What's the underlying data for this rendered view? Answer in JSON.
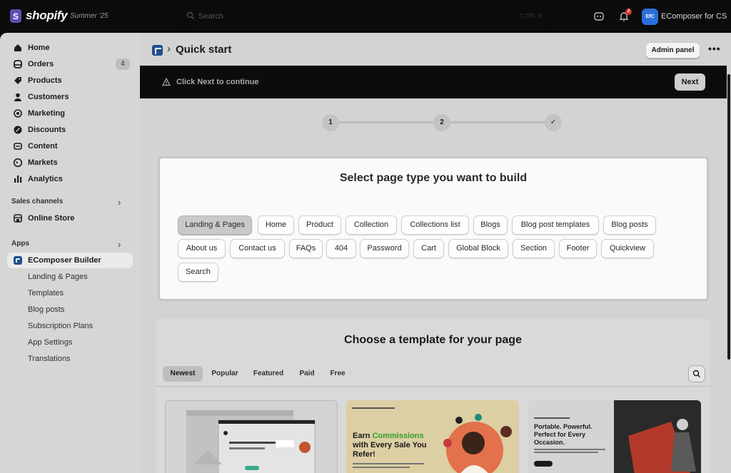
{
  "topbar": {
    "logo_mark": "S",
    "logo_text": "shopify",
    "edition": "Summer '25",
    "search_placeholder": "Search",
    "search_shortcut": "CTRL  K",
    "notification_count": "2",
    "avatar_initials": "EfC",
    "store_name": "EComposer for CS"
  },
  "sidebar": {
    "items": [
      {
        "label": "Home",
        "icon": "home-icon"
      },
      {
        "label": "Orders",
        "icon": "orders-icon",
        "badge": "4"
      },
      {
        "label": "Products",
        "icon": "tag-icon"
      },
      {
        "label": "Customers",
        "icon": "person-icon"
      },
      {
        "label": "Marketing",
        "icon": "target-icon"
      },
      {
        "label": "Discounts",
        "icon": "discount-icon"
      },
      {
        "label": "Content",
        "icon": "content-icon"
      },
      {
        "label": "Markets",
        "icon": "globe-icon"
      },
      {
        "label": "Analytics",
        "icon": "bar-chart-icon"
      }
    ],
    "sales_channels_heading": "Sales channels",
    "online_store": "Online Store",
    "apps_heading": "Apps",
    "app_name": "EComposer Builder",
    "app_subitems": [
      "Landing & Pages",
      "Templates",
      "Blog posts",
      "Subscription Plans",
      "App Settings",
      "Translations"
    ]
  },
  "page": {
    "breadcrumb_sep": "›",
    "title": "Quick start",
    "admin_panel": "Admin panel",
    "more": "•••"
  },
  "banner": {
    "text": "Click Next to continue",
    "next": "Next"
  },
  "stepper": {
    "steps": [
      "1",
      "2",
      "✓"
    ]
  },
  "select_page": {
    "title": "Select page type you want to build",
    "types": [
      "Landing & Pages",
      "Home",
      "Product",
      "Collection",
      "Collections list",
      "Blogs",
      "Blog post templates",
      "Blog posts",
      "About us",
      "Contact us",
      "FAQs",
      "404",
      "Password",
      "Cart",
      "Global Block",
      "Section",
      "Footer",
      "Quickview",
      "Search"
    ],
    "selected": "Landing & Pages"
  },
  "templates": {
    "title": "Choose a template for your page",
    "tabs": [
      "Newest",
      "Popular",
      "Featured",
      "Paid",
      "Free"
    ],
    "selected_tab": "Newest",
    "thumb2": {
      "line1a": "Earn ",
      "line1b": "Commissions",
      "line2": "with Every Sale You",
      "line3": "Refer!"
    },
    "thumb3": {
      "line1": "Portable. Powerful.",
      "line2": "Perfect for Every",
      "line3": "Occasion."
    }
  },
  "colors": {
    "accent_purple": "#5e4db2",
    "commission_green": "#2f9e2f",
    "avatar_blue": "#2a6fdb"
  }
}
